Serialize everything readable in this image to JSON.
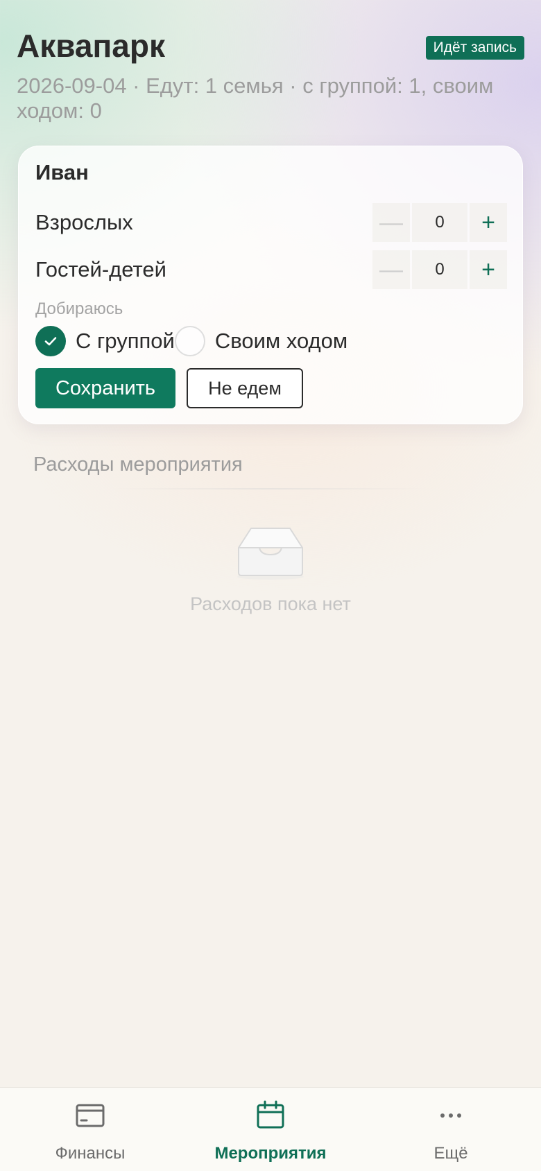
{
  "header": {
    "title": "Аквапарк",
    "status_badge": "Идёт запись",
    "subtitle": "2026-09-04 · Едут: 1 семья · с группой: 1, своим ходом: 0"
  },
  "card": {
    "member_name": "Иван",
    "adults": {
      "label": "Взрослых",
      "value": "0",
      "minus": "—",
      "plus": "+"
    },
    "guest_children": {
      "label": "Гостей-детей",
      "value": "0",
      "minus": "—",
      "plus": "+"
    },
    "route": {
      "label": "Добираюсь",
      "options": [
        {
          "label": "С группой",
          "selected": true
        },
        {
          "label": "Своим ходом",
          "selected": false
        }
      ]
    },
    "save_label": "Сохранить",
    "decline_label": "Не едем"
  },
  "expenses": {
    "title": "Расходы мероприятия",
    "empty_text": "Расходов пока нет",
    "empty_icon": "inbox-icon"
  },
  "bottom_nav": {
    "items": [
      {
        "label": "Финансы",
        "icon": "card-icon",
        "active": false
      },
      {
        "label": "Мероприятия",
        "icon": "calendar-icon",
        "active": true
      },
      {
        "label": "Ещё",
        "icon": "more-icon",
        "active": false
      }
    ]
  },
  "colors": {
    "accent": "#0f6f56",
    "button_primary": "#0f7a5e",
    "text": "#2b2b2b",
    "muted": "#9c9c9c"
  }
}
